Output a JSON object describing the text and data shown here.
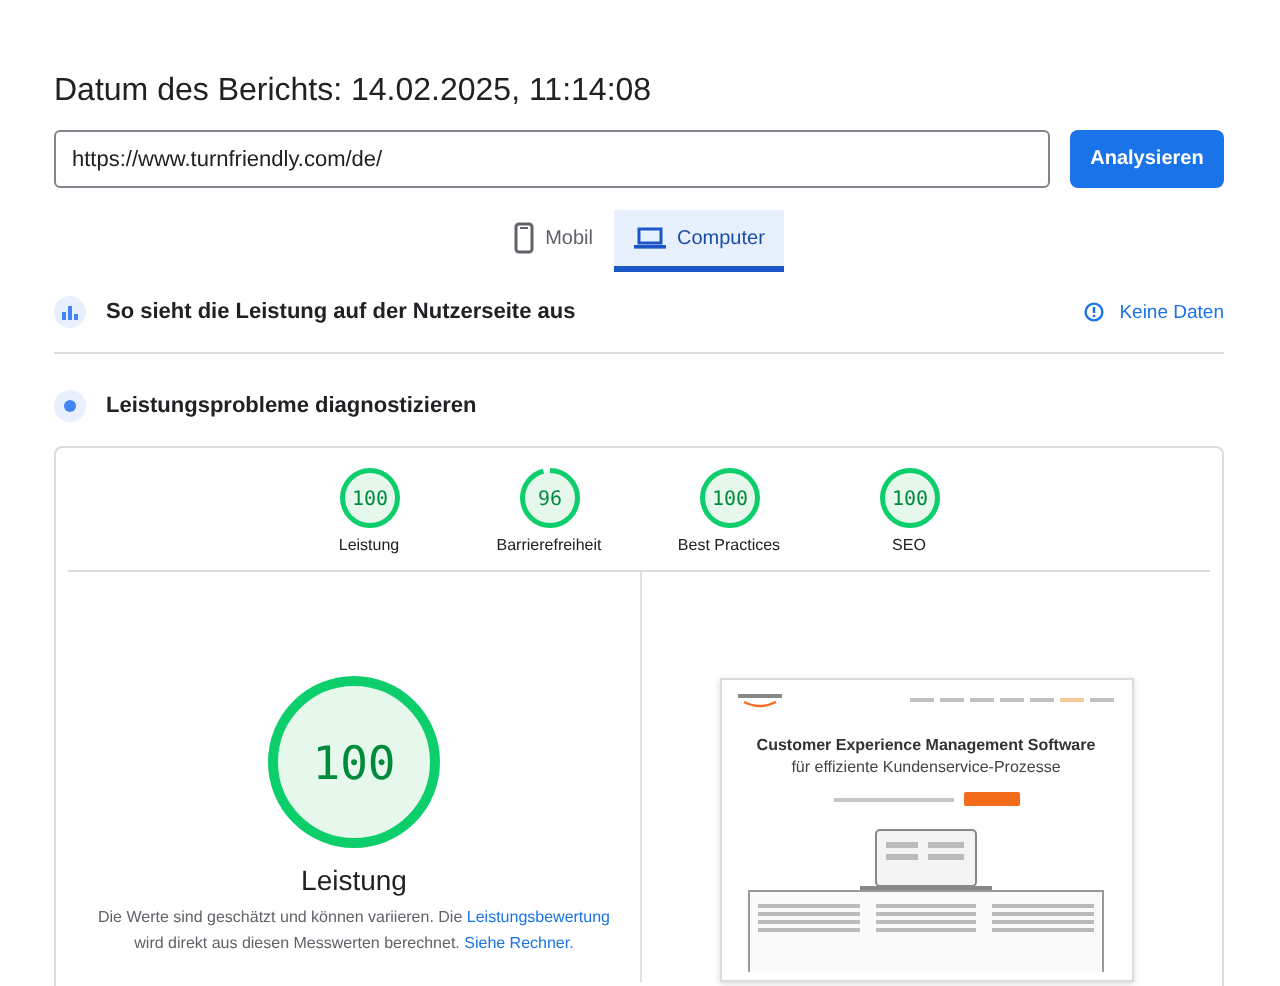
{
  "report": {
    "title": "Datum des Berichts: 14.02.2025, 11:14:08"
  },
  "url_field": {
    "value": "https://www.turnfriendly.com/de/"
  },
  "analyze_button": {
    "label": "Analysieren"
  },
  "tabs": [
    {
      "label": "Mobil",
      "kind": "phone",
      "selected": false
    },
    {
      "label": "Computer",
      "kind": "laptop",
      "selected": true
    }
  ],
  "field_data": {
    "heading": "So sieht die Leistung auf der Nutzerseite aus",
    "status": "Keine Daten"
  },
  "diagnostics": {
    "heading": "Leistungsprobleme diagnostizieren",
    "categories": [
      {
        "score": "100",
        "label": "Leistung",
        "level": 1
      },
      {
        "score": "96",
        "label": "Barrierefreiheit",
        "level": 0.96
      },
      {
        "score": "100",
        "label": "Best Practices",
        "level": 1
      },
      {
        "score": "100",
        "label": "SEO",
        "level": 1
      }
    ],
    "main": {
      "score": "100",
      "level": 1,
      "label": "Leistung",
      "description": [
        {
          "kind": "text",
          "text": "Die Werte sind geschätzt und können variieren. Die "
        },
        {
          "kind": "link",
          "text": "Leistungsbewertung"
        },
        {
          "kind": "text",
          "text": " wird direkt aus diesen Messwerten berechnet. "
        },
        {
          "kind": "link",
          "text": "Siehe Rechner."
        }
      ]
    },
    "preview": {
      "headline": "Customer Experience Management Software",
      "subheadline": "für effiziente Kundenservice-Prozesse"
    }
  }
}
